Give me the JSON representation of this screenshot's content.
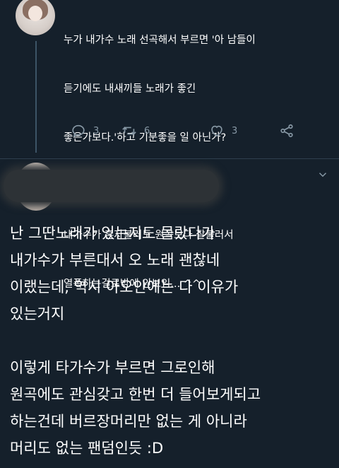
{
  "tweet1": {
    "lines": [
      "누가 내가수 노래 선곡해서 부르면 '아 남들이",
      "듣기에도 내새끼들 노래가 좋긴",
      "좋은가보다.'하고 기분좋을 일 아닌가?",
      "",
      "내가수가 혼자불러도 원곡보다 잘불러서",
      "열폭하는걸로밖에 안보임... ^^"
    ],
    "actions": {
      "reply_icon": "reply-icon",
      "reply_count": "3",
      "retweet_icon": "retweet-icon",
      "retweet_count": "6",
      "like_icon": "heart-icon",
      "like_count": "3",
      "share_icon": "share-icon"
    }
  },
  "tweet2": {
    "menu_icon": "chevron-down-icon",
    "lines": [
      "난 그딴노래가 있는지도 몰랐다가",
      "내가수가 부른대서 오 노래 괜찮네",
      "이랬는데, 역시 아오안에는 다 이유가",
      "있는거지",
      "",
      "이렇게 타가수가 부르면 그로인해",
      "원곡에도 관심갖고 한번 더 들어보게되고",
      "하는건데 버르장머리만 없는 게 아니라",
      "머리도 없는 팬덤인듯 :D"
    ]
  },
  "colors": {
    "background": "#15202b",
    "text": "#ffffff",
    "muted": "#8899a6",
    "thread_line": "#3d5466"
  }
}
